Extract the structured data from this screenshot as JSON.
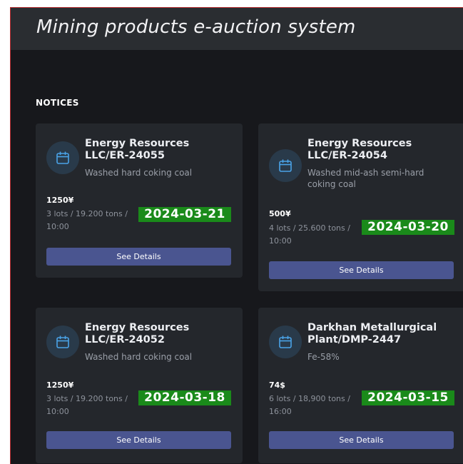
{
  "header": {
    "title": "Mining products e-auction system"
  },
  "notices": {
    "title": "NOTICES",
    "cards": [
      {
        "title": "Energy Resources LLC/ER-24055",
        "subtitle": "Washed hard coking coal",
        "price": "1250¥",
        "lots": "3 lots / 19.200 tons /",
        "time": "10:00",
        "date": "2024-03-21",
        "button": "See Details"
      },
      {
        "title": "Energy Resources LLC/ER-24054",
        "subtitle": "Washed mid-ash semi-hard coking coal",
        "price": "500¥",
        "lots": "4 lots / 25.600 tons /",
        "time": "10:00",
        "date": "2024-03-20",
        "button": "See Details"
      },
      {
        "title": "Energy Resources LLC/ER-24052",
        "subtitle": "Washed hard coking coal",
        "price": "1250¥",
        "lots": "3 lots / 19.200 tons /",
        "time": "10:00",
        "date": "2024-03-18",
        "button": "See Details"
      },
      {
        "title": "Darkhan Metallurgical Plant/DMP-2447",
        "subtitle": "Fe-58%",
        "price": "74$",
        "lots": "6 lots / 18,900 tons /",
        "time": "16:00",
        "date": "2024-03-15",
        "button": "See Details"
      }
    ]
  },
  "icons": {
    "card_icon": "calendar-icon"
  },
  "colors": {
    "accent_button": "#4a5590",
    "date_badge": "#1a8a1a",
    "icon_circle": "#293a4a"
  }
}
